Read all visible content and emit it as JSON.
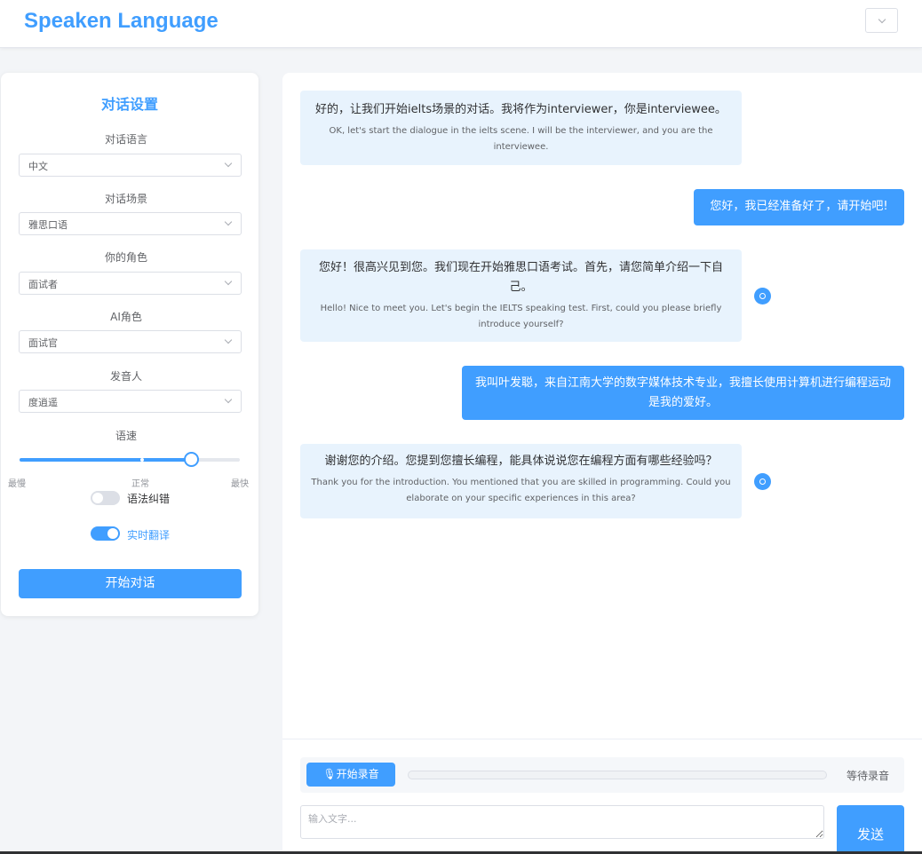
{
  "header": {
    "title": "Speaken Language"
  },
  "settings": {
    "title": "对话设置",
    "fields": [
      {
        "label": "对话语言",
        "value": "中文"
      },
      {
        "label": "对话场景",
        "value": "雅思口语"
      },
      {
        "label": "你的角色",
        "value": "面试者"
      },
      {
        "label": "AI角色",
        "value": "面试官"
      },
      {
        "label": "发音人",
        "value": "度逍遥"
      }
    ],
    "speed": {
      "label": "语速",
      "marks": {
        "min": "最慢",
        "mid": "正常",
        "max": "最快"
      },
      "level": 0.78
    },
    "grammar_toggle": {
      "label": "语法纠错",
      "on": false
    },
    "translate_toggle": {
      "label": "实时翻译",
      "on": true
    },
    "start_label": "开始对话"
  },
  "chat": {
    "messages": [
      {
        "role": "ai",
        "zh": "好的，让我们开始ielts场景的对话。我将作为interviewer，你是interviewee。",
        "en": "OK, let's start the dialogue in the ielts scene. I will be the interviewer, and you are the interviewee."
      },
      {
        "role": "user",
        "text": "您好，我已经准备好了，请开始吧!"
      },
      {
        "role": "ai",
        "zh": "您好！很高兴见到您。我们现在开始雅思口语考试。首先，请您简单介绍一下自己。",
        "en": "Hello! Nice to meet you. Let's begin the IELTS speaking test. First, could you please briefly introduce yourself?"
      },
      {
        "role": "user",
        "text": "我叫叶发聪，来自江南大学的数字媒体技术专业，我擅长使用计算机进行编程运动是我的爱好。"
      },
      {
        "role": "ai",
        "zh": "谢谢您的介绍。您提到您擅长编程，能具体说说您在编程方面有哪些经验吗？",
        "en": "Thank you for the introduction. You mentioned that you are skilled in programming. Could you elaborate on your specific experiences in this area?"
      }
    ],
    "record_label": "🎙开始录音",
    "record_status": "等待录音",
    "input_placeholder": "输入文字...",
    "send_label": "发送"
  },
  "colors": {
    "accent": "#409eff",
    "ai_bubble": "#e8f3fd"
  },
  "icons": {
    "dropdown": "chevron-down-icon",
    "speaker": "speaker-icon",
    "mic": "microphone-icon"
  }
}
